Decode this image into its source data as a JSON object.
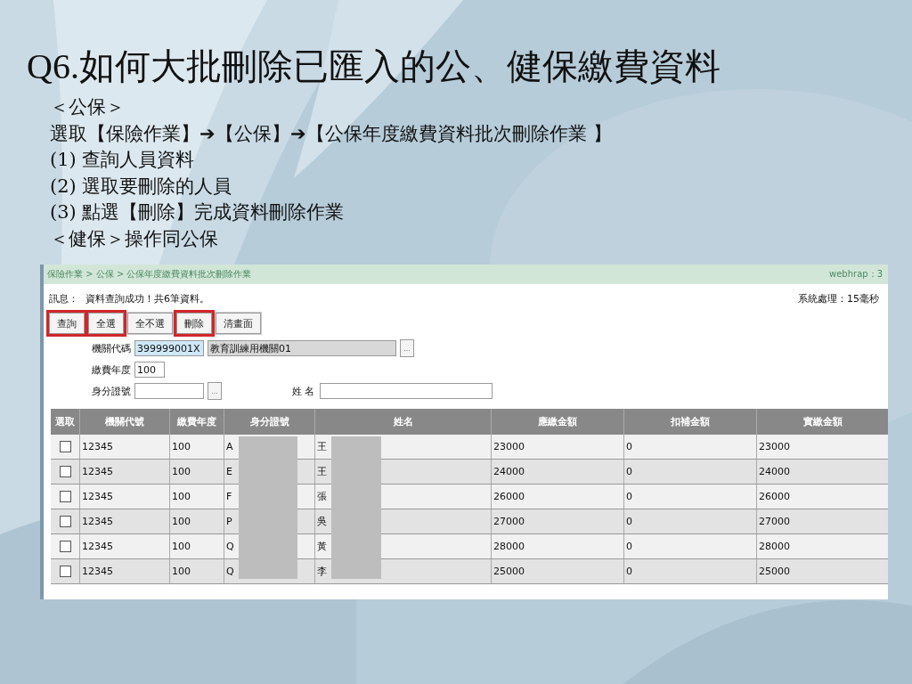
{
  "slide": {
    "title": "Q6.如何大批刪除已匯入的公、健保繳費資料",
    "lines": [
      "＜公保＞",
      "選取【保險作業】➔【公保】➔【公保年度繳費資料批次刪除作業 】",
      "(1) 查詢人員資料",
      "(2) 選取要刪除的人員",
      "(3) 點選【刪除】完成資料刪除作業",
      "＜健保＞操作同公保"
    ]
  },
  "screen": {
    "breadcrumb": "保險作業 > 公保 > 公保年度繳費資料批次刪除作業",
    "server": "webhrap：3",
    "message_label": "訊息：",
    "message": "資料查詢成功！共6筆資料。",
    "timing": "系統處理：15毫秒",
    "buttons": [
      {
        "label": "查詢",
        "highlighted": true
      },
      {
        "label": "全選",
        "highlighted": true
      },
      {
        "label": "全不選",
        "highlighted": false
      },
      {
        "label": "刪除",
        "highlighted": true
      },
      {
        "label": "清畫面",
        "highlighted": false
      }
    ],
    "form": {
      "org_label": "機關代碼",
      "org_code": "399999001X",
      "org_name": "教育訓練用機關01",
      "lookup": "...",
      "year_label": "繳費年度",
      "year": "100",
      "id_label": "身分證號",
      "id_lookup": "...",
      "name_label": "姓 名"
    },
    "table": {
      "columns": [
        "選取",
        "機關代號",
        "繳費年度",
        "身分證號",
        "姓名",
        "應繳金額",
        "扣補金額",
        "實繳金額"
      ],
      "rows": [
        {
          "checked": false,
          "cells": [
            "",
            "12345",
            "100",
            "A",
            "王",
            "23000",
            "0",
            "23000"
          ]
        },
        {
          "checked": false,
          "cells": [
            "",
            "12345",
            "100",
            "E",
            "王",
            "24000",
            "0",
            "24000"
          ]
        },
        {
          "checked": false,
          "cells": [
            "",
            "12345",
            "100",
            "F",
            "張",
            "26000",
            "0",
            "26000"
          ]
        },
        {
          "checked": false,
          "cells": [
            "",
            "12345",
            "100",
            "P",
            "吳",
            "27000",
            "0",
            "27000"
          ]
        },
        {
          "checked": false,
          "cells": [
            "",
            "12345",
            "100",
            "Q",
            "黃",
            "28000",
            "0",
            "28000"
          ]
        },
        {
          "checked": false,
          "cells": [
            "",
            "12345",
            "100",
            "Q",
            "李",
            "25000",
            "0",
            "25000"
          ]
        }
      ]
    }
  }
}
